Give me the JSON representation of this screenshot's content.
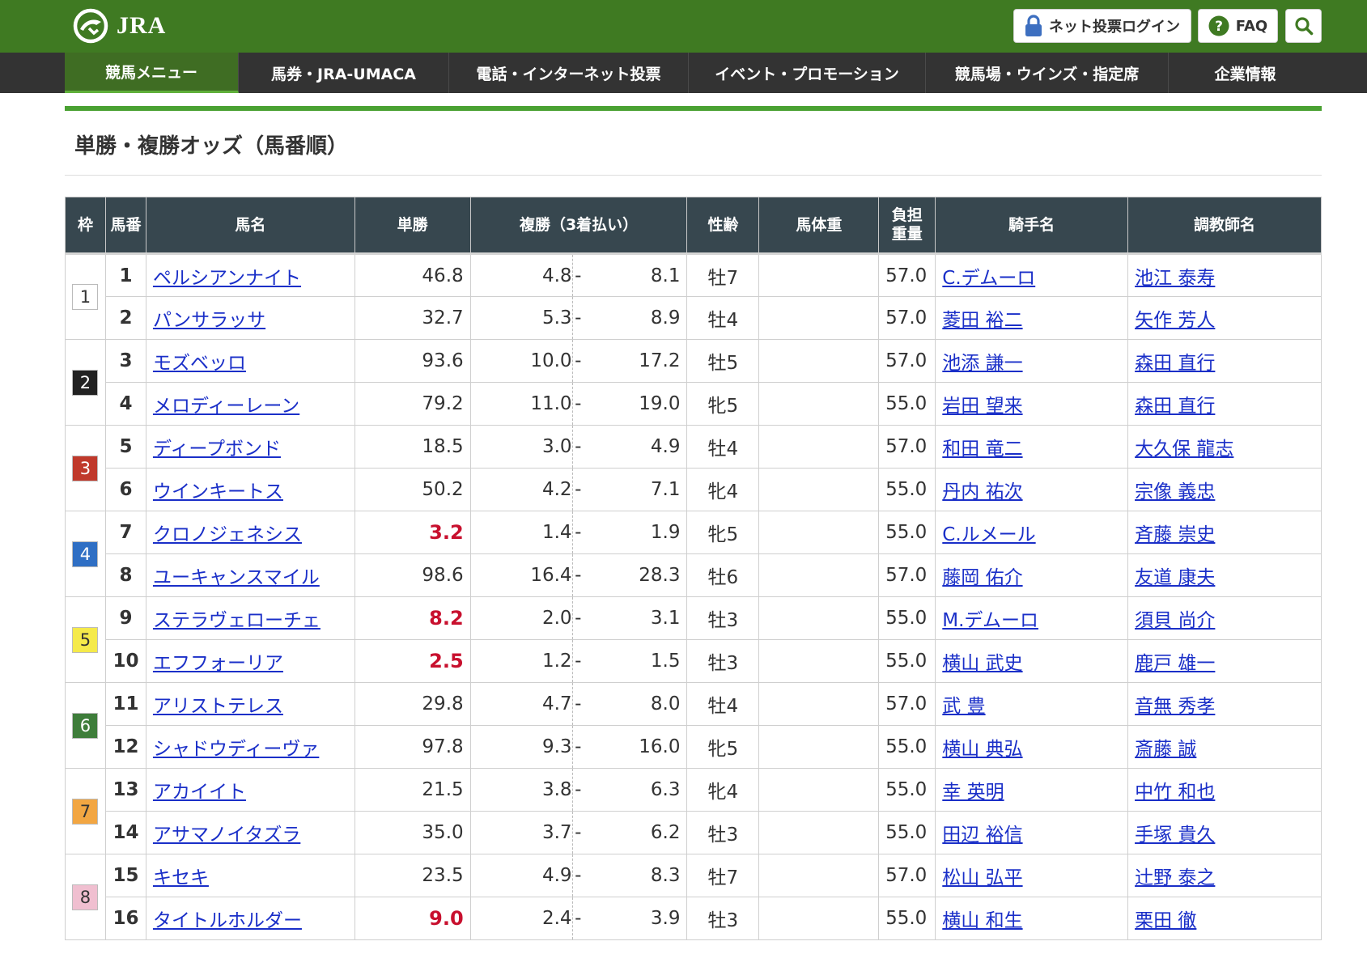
{
  "header": {
    "logo_text": "JRA",
    "login_label": "ネット投票ログイン",
    "faq_label": "FAQ",
    "colors": {
      "brand_green": "#3f7a22",
      "nav_bg": "#333333",
      "active_nav": "#3f6d23"
    }
  },
  "nav": [
    {
      "label": "競馬メニュー",
      "active": true
    },
    {
      "label": "馬券・JRA-UMACA",
      "active": false
    },
    {
      "label": "電話・インターネット投票",
      "active": false
    },
    {
      "label": "イベント・プロモーション",
      "active": false
    },
    {
      "label": "競馬場・ウインズ・指定席",
      "active": false
    },
    {
      "label": "企業情報",
      "active": false
    }
  ],
  "page": {
    "title": "単勝・複勝オッズ（馬番順）"
  },
  "table": {
    "headers": {
      "waku": "枠",
      "umaban": "馬番",
      "name": "馬名",
      "tan": "単勝",
      "fuku": "複勝（3着払い）",
      "sex_age": "性齢",
      "body_weight": "馬体重",
      "weight_line1": "負担",
      "weight_line2": "重量",
      "jockey": "騎手名",
      "trainer": "調教師名"
    },
    "waku_colors": {
      "1": {
        "bg": "#ffffff",
        "fg": "#333333"
      },
      "2": {
        "bg": "#222222",
        "fg": "#ffffff"
      },
      "3": {
        "bg": "#c0392b",
        "fg": "#ffffff"
      },
      "4": {
        "bg": "#2f6fc4",
        "fg": "#ffffff"
      },
      "5": {
        "bg": "#f5ea4a",
        "fg": "#333333"
      },
      "6": {
        "bg": "#3e7d3a",
        "fg": "#ffffff"
      },
      "7": {
        "bg": "#f2a642",
        "fg": "#333333"
      },
      "8": {
        "bg": "#f0bfd0",
        "fg": "#333333"
      }
    },
    "rows": [
      {
        "waku": "1",
        "umaban": "1",
        "name": "ペルシアンナイト",
        "tan": "46.8",
        "fav": false,
        "fmin": "4.8",
        "fmax": "8.1",
        "sex_age": "牡7",
        "body_weight": "",
        "weight": "57.0",
        "jockey": "C.デムーロ",
        "trainer": "池江 泰寿"
      },
      {
        "waku": "1",
        "umaban": "2",
        "name": "パンサラッサ",
        "tan": "32.7",
        "fav": false,
        "fmin": "5.3",
        "fmax": "8.9",
        "sex_age": "牡4",
        "body_weight": "",
        "weight": "57.0",
        "jockey": "菱田 裕二",
        "trainer": "矢作 芳人"
      },
      {
        "waku": "2",
        "umaban": "3",
        "name": "モズベッロ",
        "tan": "93.6",
        "fav": false,
        "fmin": "10.0",
        "fmax": "17.2",
        "sex_age": "牡5",
        "body_weight": "",
        "weight": "57.0",
        "jockey": "池添 謙一",
        "trainer": "森田 直行"
      },
      {
        "waku": "2",
        "umaban": "4",
        "name": "メロディーレーン",
        "tan": "79.2",
        "fav": false,
        "fmin": "11.0",
        "fmax": "19.0",
        "sex_age": "牝5",
        "body_weight": "",
        "weight": "55.0",
        "jockey": "岩田 望来",
        "trainer": "森田 直行"
      },
      {
        "waku": "3",
        "umaban": "5",
        "name": "ディープボンド",
        "tan": "18.5",
        "fav": false,
        "fmin": "3.0",
        "fmax": "4.9",
        "sex_age": "牡4",
        "body_weight": "",
        "weight": "57.0",
        "jockey": "和田 竜二",
        "trainer": "大久保 龍志"
      },
      {
        "waku": "3",
        "umaban": "6",
        "name": "ウインキートス",
        "tan": "50.2",
        "fav": false,
        "fmin": "4.2",
        "fmax": "7.1",
        "sex_age": "牝4",
        "body_weight": "",
        "weight": "55.0",
        "jockey": "丹内 祐次",
        "trainer": "宗像 義忠"
      },
      {
        "waku": "4",
        "umaban": "7",
        "name": "クロノジェネシス",
        "tan": "3.2",
        "fav": true,
        "fmin": "1.4",
        "fmax": "1.9",
        "sex_age": "牝5",
        "body_weight": "",
        "weight": "55.0",
        "jockey": "C.ルメール",
        "trainer": "斉藤 崇史"
      },
      {
        "waku": "4",
        "umaban": "8",
        "name": "ユーキャンスマイル",
        "tan": "98.6",
        "fav": false,
        "fmin": "16.4",
        "fmax": "28.3",
        "sex_age": "牡6",
        "body_weight": "",
        "weight": "57.0",
        "jockey": "藤岡 佑介",
        "trainer": "友道 康夫"
      },
      {
        "waku": "5",
        "umaban": "9",
        "name": "ステラヴェローチェ",
        "tan": "8.2",
        "fav": true,
        "fmin": "2.0",
        "fmax": "3.1",
        "sex_age": "牡3",
        "body_weight": "",
        "weight": "55.0",
        "jockey": "M.デムーロ",
        "trainer": "須貝 尚介"
      },
      {
        "waku": "5",
        "umaban": "10",
        "name": "エフフォーリア",
        "tan": "2.5",
        "fav": true,
        "fmin": "1.2",
        "fmax": "1.5",
        "sex_age": "牡3",
        "body_weight": "",
        "weight": "55.0",
        "jockey": "横山 武史",
        "trainer": "鹿戸 雄一"
      },
      {
        "waku": "6",
        "umaban": "11",
        "name": "アリストテレス",
        "tan": "29.8",
        "fav": false,
        "fmin": "4.7",
        "fmax": "8.0",
        "sex_age": "牡4",
        "body_weight": "",
        "weight": "57.0",
        "jockey": "武 豊",
        "trainer": "音無 秀孝"
      },
      {
        "waku": "6",
        "umaban": "12",
        "name": "シャドウディーヴァ",
        "tan": "97.8",
        "fav": false,
        "fmin": "9.3",
        "fmax": "16.0",
        "sex_age": "牝5",
        "body_weight": "",
        "weight": "55.0",
        "jockey": "横山 典弘",
        "trainer": "斎藤 誠"
      },
      {
        "waku": "7",
        "umaban": "13",
        "name": "アカイイト",
        "tan": "21.5",
        "fav": false,
        "fmin": "3.8",
        "fmax": "6.3",
        "sex_age": "牝4",
        "body_weight": "",
        "weight": "55.0",
        "jockey": "幸 英明",
        "trainer": "中竹 和也"
      },
      {
        "waku": "7",
        "umaban": "14",
        "name": "アサマノイタズラ",
        "tan": "35.0",
        "fav": false,
        "fmin": "3.7",
        "fmax": "6.2",
        "sex_age": "牡3",
        "body_weight": "",
        "weight": "55.0",
        "jockey": "田辺 裕信",
        "trainer": "手塚 貴久"
      },
      {
        "waku": "8",
        "umaban": "15",
        "name": "キセキ",
        "tan": "23.5",
        "fav": false,
        "fmin": "4.9",
        "fmax": "8.3",
        "sex_age": "牡7",
        "body_weight": "",
        "weight": "57.0",
        "jockey": "松山 弘平",
        "trainer": "辻野 泰之"
      },
      {
        "waku": "8",
        "umaban": "16",
        "name": "タイトルホルダー",
        "tan": "9.0",
        "fav": true,
        "fmin": "2.4",
        "fmax": "3.9",
        "sex_age": "牡3",
        "body_weight": "",
        "weight": "55.0",
        "jockey": "横山 和生",
        "trainer": "栗田 徹"
      }
    ]
  }
}
